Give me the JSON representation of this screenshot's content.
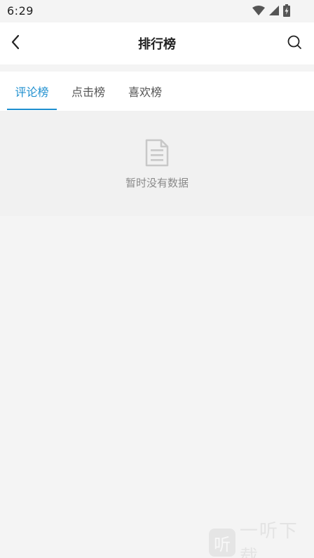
{
  "status_bar": {
    "time": "6:29",
    "icons": [
      "wifi-icon",
      "signal-icon",
      "battery-charging-icon"
    ]
  },
  "header": {
    "title": "排行榜",
    "back_icon": "chevron-left-icon",
    "search_icon": "search-icon"
  },
  "tabs": [
    {
      "label": "评论榜",
      "active": true
    },
    {
      "label": "点击榜",
      "active": false
    },
    {
      "label": "喜欢榜",
      "active": false
    }
  ],
  "empty_state": {
    "icon": "document-icon",
    "text": "暂时没有数据"
  },
  "watermark": {
    "logo_char": "听",
    "text": "一听下载"
  },
  "colors": {
    "accent": "#1e8fcf",
    "background": "#f4f4f4",
    "surface": "#ffffff",
    "muted_text": "#8a8a8a"
  }
}
